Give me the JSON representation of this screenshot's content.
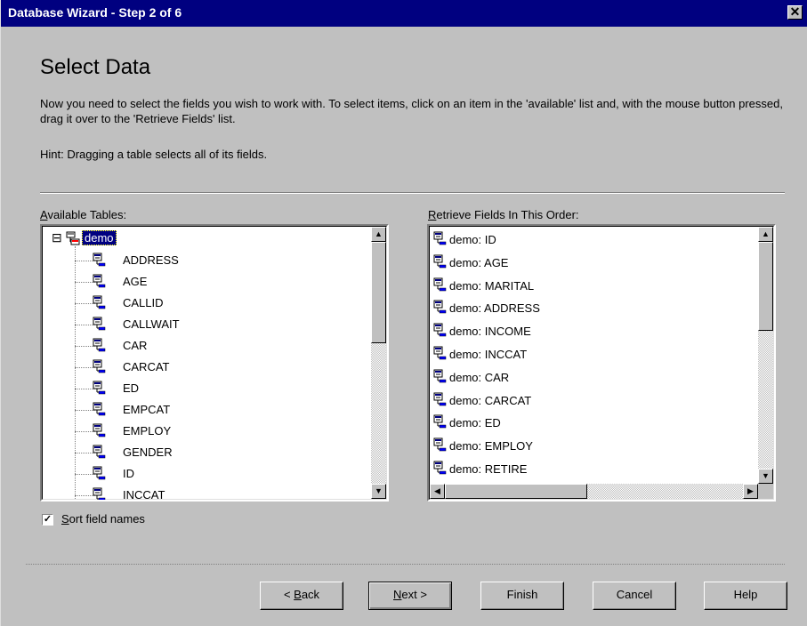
{
  "window": {
    "title": "Database Wizard - Step 2 of 6",
    "close_label": "✕"
  },
  "page": {
    "heading": "Select Data",
    "description": "Now you need to select the fields you wish to work with. To select items, click on an item in the 'available' list and, with the mouse button pressed, drag it over to the 'Retrieve Fields' list.",
    "hint": "Hint: Dragging a table selects all of its fields."
  },
  "available": {
    "label_mnemonic": "A",
    "label_rest": "vailable Tables:",
    "table_name": "demo",
    "expander": "⊟",
    "fields": [
      "ADDRESS",
      "AGE",
      "CALLID",
      "CALLWAIT",
      "CAR",
      "CARCAT",
      "ED",
      "EMPCAT",
      "EMPLOY",
      "GENDER",
      "ID",
      "INCCAT"
    ]
  },
  "retrieve": {
    "label_mnemonic": "R",
    "label_rest": "etrieve Fields In This Order:",
    "fields": [
      "demo: ID",
      "demo: AGE",
      "demo: MARITAL",
      "demo: ADDRESS",
      "demo: INCOME",
      "demo: INCCAT",
      "demo: CAR",
      "demo: CARCAT",
      "demo: ED",
      "demo: EMPLOY",
      "demo: RETIRE"
    ]
  },
  "sort": {
    "checked": true,
    "mark": "✓",
    "label_mnemonic": "S",
    "label_rest": "ort field names"
  },
  "buttons": {
    "back_prefix": "< ",
    "back_mnemonic": "B",
    "back_rest": "ack",
    "next_mnemonic": "N",
    "next_rest": "ext >",
    "finish": "Finish",
    "cancel": "Cancel",
    "help": "Help"
  },
  "colors": {
    "titlebar": "#000080",
    "selection": "#000080",
    "face": "#c0c0c0"
  }
}
